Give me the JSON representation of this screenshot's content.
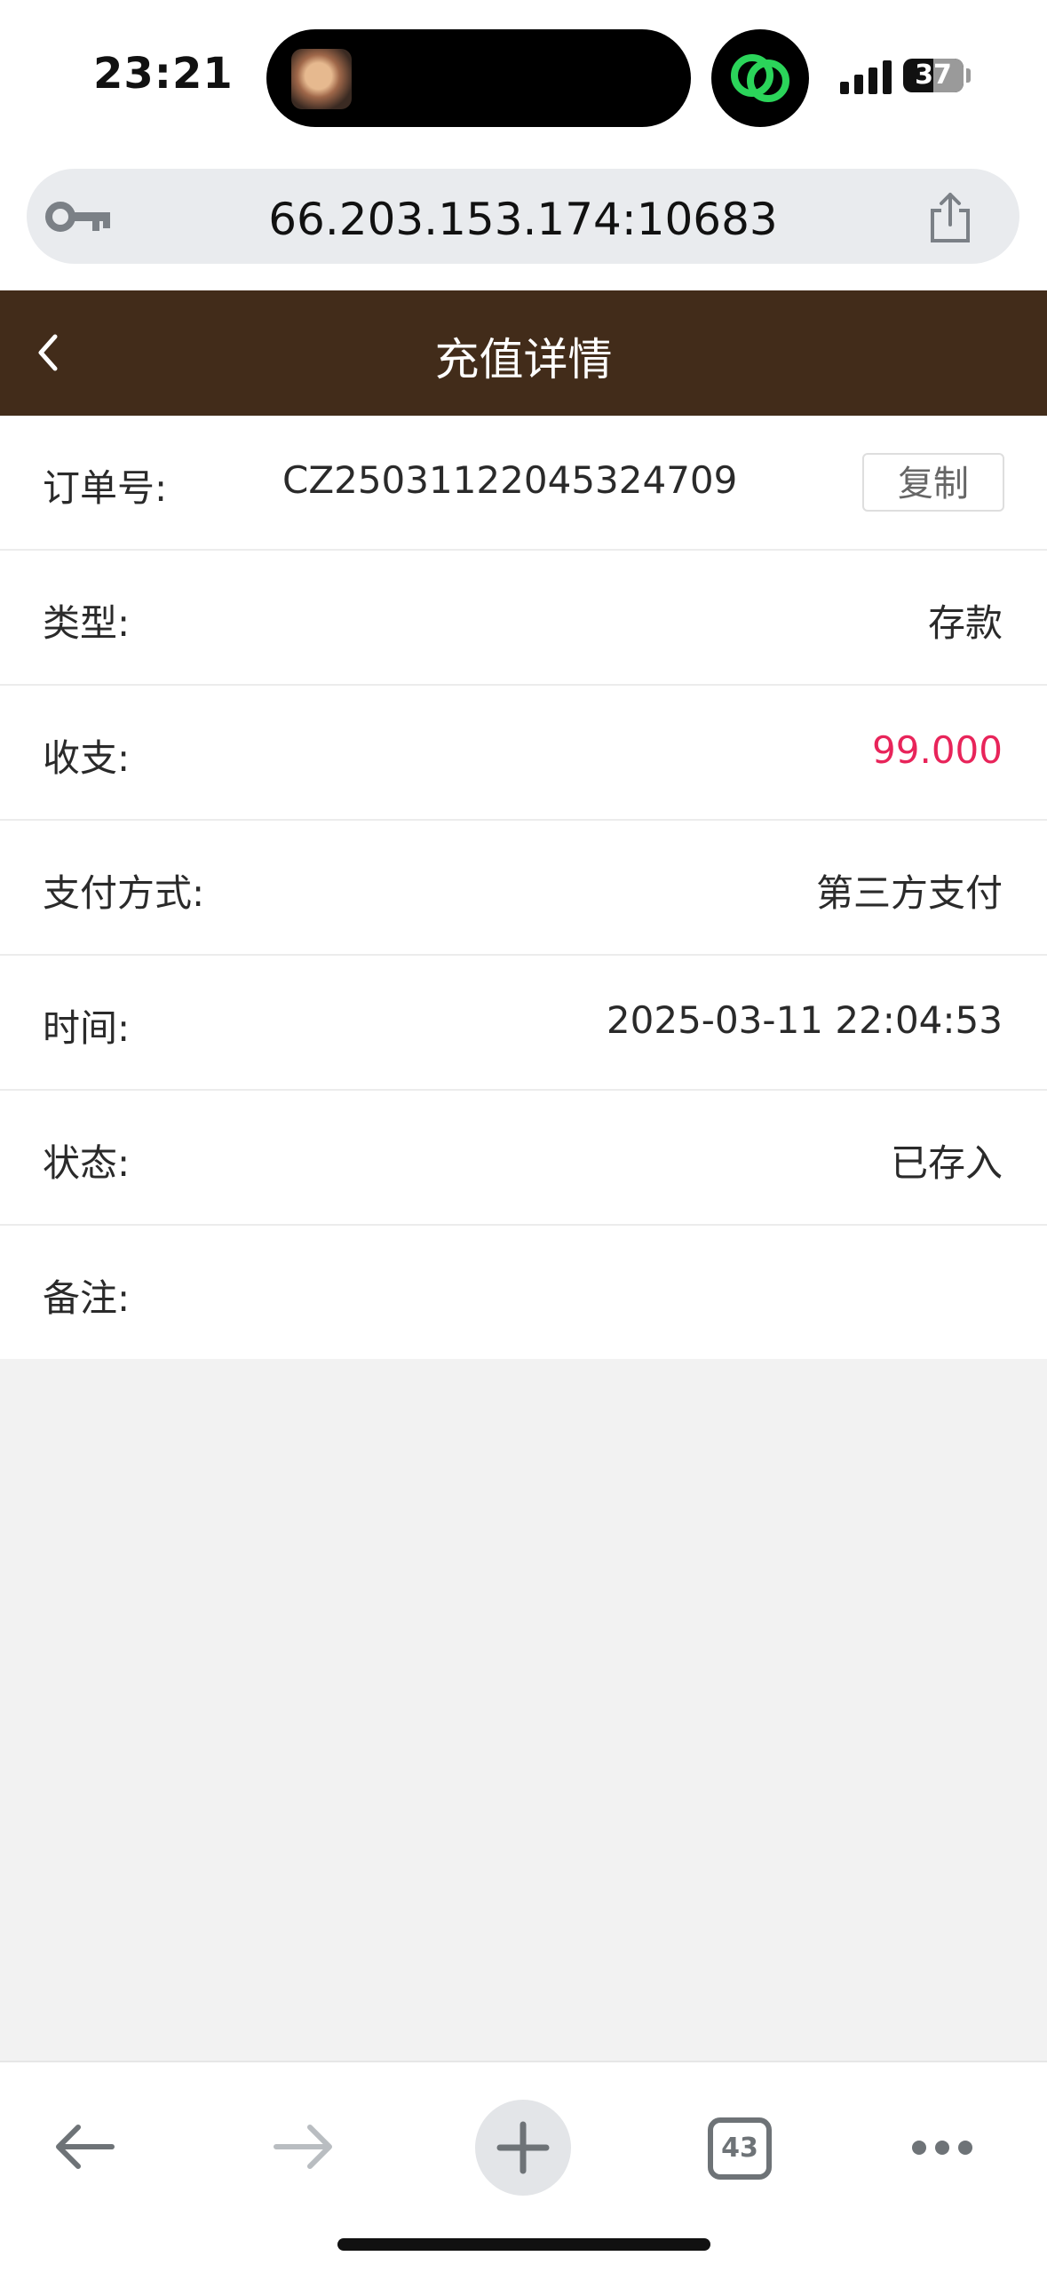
{
  "status_bar": {
    "time": "23:21",
    "battery": "37",
    "icons": [
      "chat-app-icon",
      "signal-icon",
      "battery-icon"
    ]
  },
  "browser": {
    "url": "66.203.153.174:10683",
    "icons": [
      "key-icon",
      "share-icon"
    ],
    "toolbar": {
      "tab_count": "43",
      "icons": [
        "back-arrow-icon",
        "forward-arrow-icon",
        "plus-icon",
        "tabs-icon",
        "more-icon"
      ]
    }
  },
  "header": {
    "title": "充值详情",
    "background": "#422c1a"
  },
  "details": {
    "order": {
      "label": "订单号:",
      "value": "CZ25031122045324709",
      "copy_label": "复制"
    },
    "type": {
      "label": "类型:",
      "value": "存款"
    },
    "amount": {
      "label": "收支:",
      "value": "99.000",
      "color": "#e8245a"
    },
    "payment": {
      "label": "支付方式:",
      "value": "第三方支付"
    },
    "time": {
      "label": "时间:",
      "value": "2025-03-11 22:04:53"
    },
    "status": {
      "label": "状态:",
      "value": "已存入"
    },
    "note": {
      "label": "备注:",
      "value": ""
    }
  }
}
